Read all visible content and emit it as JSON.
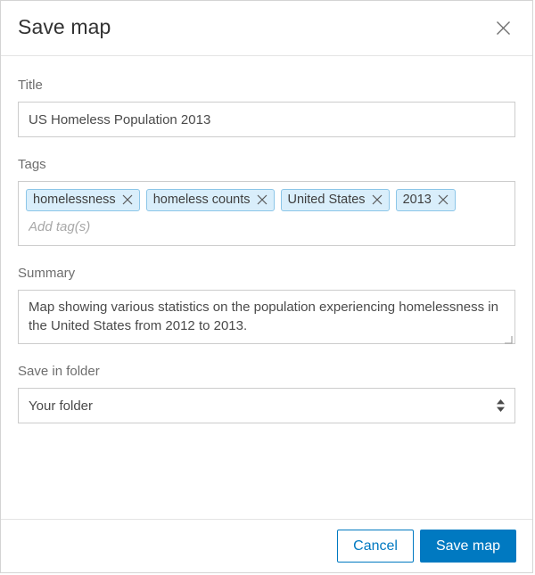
{
  "dialog": {
    "title": "Save map",
    "close_icon": "close-icon"
  },
  "title_field": {
    "label": "Title",
    "value": "US Homeless Population 2013",
    "placeholder": ""
  },
  "tags_field": {
    "label": "Tags",
    "placeholder": "Add tag(s)",
    "value": "",
    "items": [
      {
        "label": "homelessness",
        "remove_icon": "close-icon"
      },
      {
        "label": "homeless counts",
        "remove_icon": "close-icon"
      },
      {
        "label": "United States",
        "remove_icon": "close-icon"
      },
      {
        "label": "2013",
        "remove_icon": "close-icon"
      }
    ]
  },
  "summary_field": {
    "label": "Summary",
    "value": "Map showing various statistics on the population experiencing homelessness in the United States from 2012 to 2013.",
    "placeholder": "",
    "resize_icon": "resize-grip-icon"
  },
  "folder_field": {
    "label": "Save in folder",
    "selected": "Your folder",
    "options": [
      "Your folder"
    ],
    "arrows_icon": "sort-arrows-icon"
  },
  "footer": {
    "cancel_label": "Cancel",
    "save_label": "Save map"
  },
  "colors": {
    "accent": "#0079c1",
    "tag_background": "#d9eefb",
    "tag_border": "#8cc6e8",
    "label_text": "#6e6e6e",
    "input_border": "#cccccc",
    "title_text": "#323232"
  }
}
